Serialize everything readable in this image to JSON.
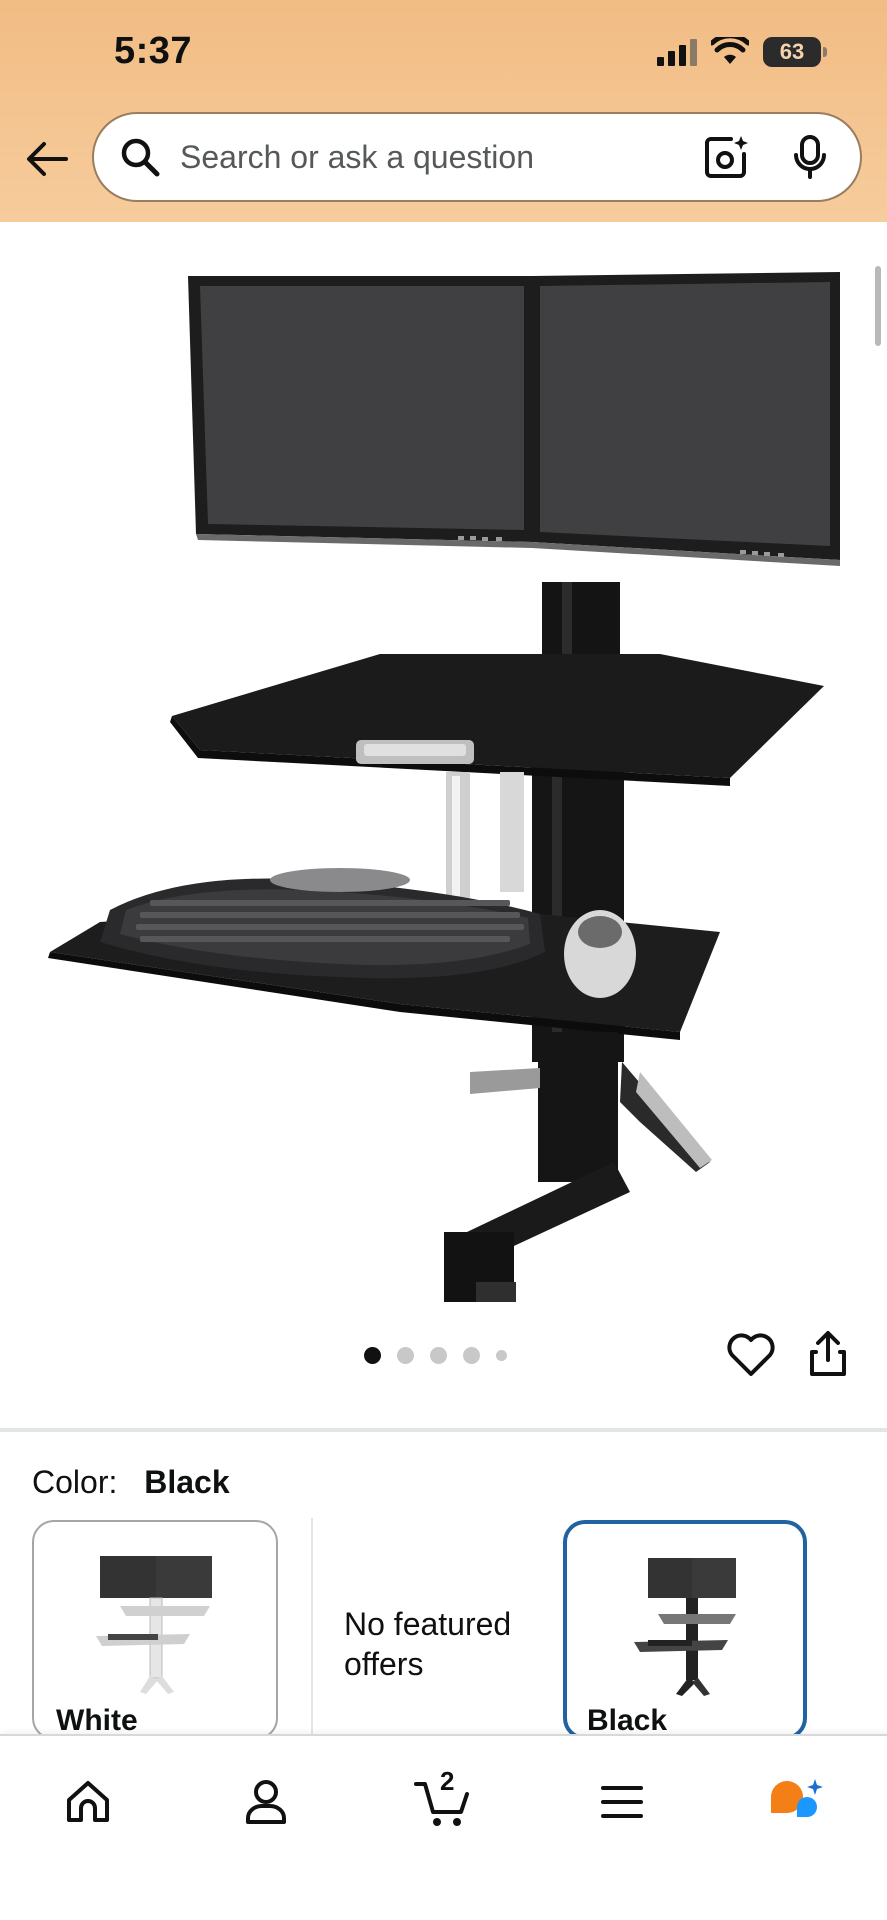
{
  "status_bar": {
    "time": "5:37",
    "battery": "63",
    "icons": [
      "cellular-signal-icon",
      "wifi-icon",
      "battery-icon"
    ]
  },
  "header": {
    "back_icon": "back-arrow-icon",
    "search": {
      "placeholder": "Search or ask a question",
      "value": "",
      "icons": [
        "search-icon",
        "camera-lens-icon",
        "microphone-icon"
      ]
    },
    "background_color": "#f2bc84"
  },
  "gallery": {
    "image_alt": "Black dual-monitor sit-stand workstation with keyboard tray",
    "image_count": 5,
    "active_index": 0,
    "actions": [
      "heart-icon",
      "share-icon"
    ]
  },
  "variation": {
    "label": "Color:",
    "selected": "Black",
    "options": [
      {
        "name": "White",
        "state": "available"
      },
      {
        "name": "",
        "note": "No featured offers"
      },
      {
        "name": "Black",
        "state": "selected"
      }
    ],
    "selected_border_color": "#2162a1"
  },
  "bottom_nav": {
    "items": [
      "home-icon",
      "account-icon",
      "cart-icon",
      "menu-icon",
      "rufus-icon"
    ],
    "cart_count": "2"
  }
}
